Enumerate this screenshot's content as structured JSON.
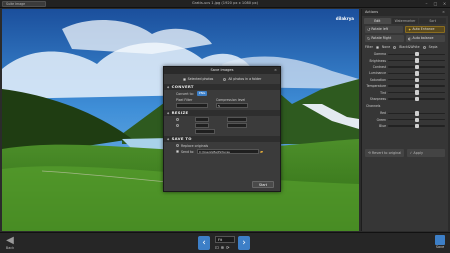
{
  "window": {
    "file_tab": "Suite Image",
    "title": "Gratis-ucs 1.jpg  (1920 px x 1080 px)",
    "controls": [
      "–",
      "□",
      "×"
    ]
  },
  "photo": {
    "watermark": "dilakrya"
  },
  "panel": {
    "title": "Actions",
    "tabs": [
      "Edit",
      "Watermarker",
      "Sort"
    ],
    "rotate_left": "Rotate left",
    "auto_enhance": "Auto Enhance",
    "rotate_right": "Rotate Right",
    "auto_balance": "Auto balance",
    "filter_label": "Filter",
    "filter_options": [
      "None",
      "Black&White",
      "Sepia"
    ],
    "sliders": [
      {
        "label": "Gamma",
        "level": 0.5
      },
      {
        "label": "Brightness",
        "level": 0.5
      },
      {
        "label": "Contrast",
        "level": 0.5
      },
      {
        "label": "Luminance",
        "level": 0.5
      },
      {
        "label": "Saturation",
        "level": 0.5
      },
      {
        "label": "Temperature",
        "level": 0.5
      },
      {
        "label": "Tint",
        "level": 0.5
      },
      {
        "label": "Sharpness",
        "level": 0.5
      }
    ],
    "channels_label": "Channels",
    "channels": [
      {
        "label": "Red",
        "level": 0.5
      },
      {
        "label": "Green",
        "level": 0.5
      },
      {
        "label": "Blue",
        "level": 0.5
      }
    ],
    "revert_label": "Revert to original",
    "apply_label": "Apply"
  },
  "bottombar": {
    "back_label": "Back",
    "zoom_value": "Fit",
    "save_label": "Save"
  },
  "dialog": {
    "title": "Save images",
    "radio_selected": "Selected photos",
    "radio_all": "All photos in a folder",
    "convert_head": "CONVERT",
    "convert_to_label": "Convert to:",
    "convert_format": "PNG",
    "pixel_filter_label": "Pixel Filter",
    "compression_label": "Compression level",
    "pixel_filter_value": "",
    "compression_value": "5",
    "resize_head": "RESIZE",
    "save_head": "SAVE TO",
    "replace_label": "Replace originals",
    "send_to_label": "Send to:",
    "send_to_path": "C:\\Users\\Me\\Pictures",
    "start_label": "Start"
  },
  "colors": {
    "accent": "#3d7fc7",
    "gold": "#f3c53b"
  }
}
